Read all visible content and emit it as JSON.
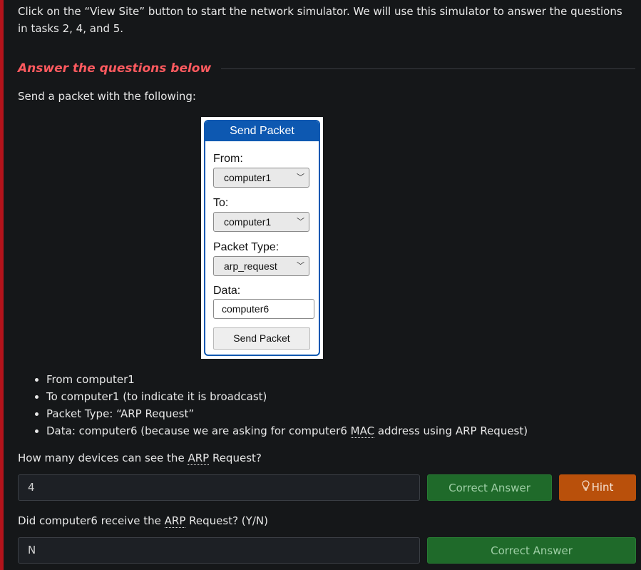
{
  "intro": "Click on the “View Site” button to start the network simulator. We will use this simulator to answer the questions in tasks 2, 4, and 5.",
  "answer_heading": "Answer the questions below",
  "send_text": "Send a packet with the following:",
  "figure": {
    "title": "Send Packet",
    "from_label": "From:",
    "from_value": "computer1",
    "to_label": "To:",
    "to_value": "computer1",
    "type_label": "Packet Type:",
    "type_value": "arp_request",
    "data_label": "Data:",
    "data_value": "computer6",
    "button": "Send Packet"
  },
  "bullets": [
    "From computer1",
    "To computer1 (to indicate it is broadcast)",
    "Packet Type: “ARP Request”",
    "Data: computer6 (because we are asking for computer6 ",
    "MAC",
    " address using ARP Request)"
  ],
  "questions": [
    {
      "text_before": "How many devices can see the ",
      "abbr": "ARP",
      "text_after": " Request?",
      "answer": "4",
      "button": "Correct Answer",
      "hint": "Hint"
    },
    {
      "text_before": "Did computer6 receive the ",
      "abbr": "ARP",
      "text_after": " Request? (Y/N)",
      "answer": "N",
      "button": "Correct Answer"
    }
  ],
  "colors": {
    "accent_red": "#b3131b",
    "heading": "#ff5a5f",
    "correct_green": "#1f6a2a",
    "hint_orange": "#b9500b",
    "packet_blue": "#0d58b1"
  }
}
